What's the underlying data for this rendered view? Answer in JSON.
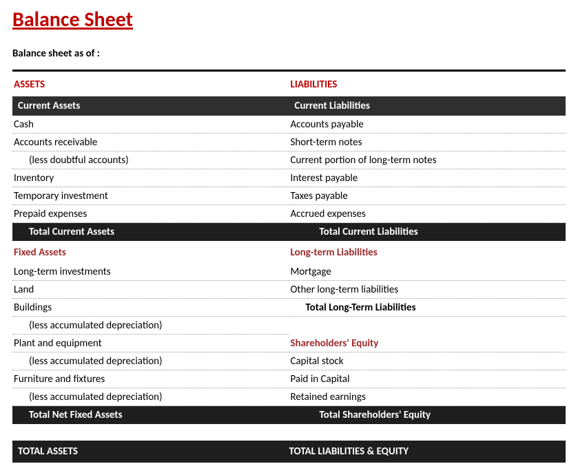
{
  "title": "Balance Sheet",
  "subtitle": "Balance sheet as of :",
  "assets": {
    "heading": "ASSETS",
    "current": {
      "band": "Current Assets",
      "rows": [
        {
          "label": "Cash",
          "indent": false
        },
        {
          "label": "Accounts receivable",
          "indent": false
        },
        {
          "label": "(less doubtful accounts)",
          "indent": true
        },
        {
          "label": "Inventory",
          "indent": false
        },
        {
          "label": "Temporary investment",
          "indent": false
        },
        {
          "label": "Prepaid expenses",
          "indent": false
        }
      ],
      "subtotal": "Total Current Assets"
    },
    "fixed": {
      "heading": "Fixed Assets",
      "rows": [
        {
          "label": "Long-term investments",
          "indent": false
        },
        {
          "label": "Land",
          "indent": false
        },
        {
          "label": "Buildings",
          "indent": false
        },
        {
          "label": "(less accumulated depreciation)",
          "indent": true
        },
        {
          "label": "Plant and equipment",
          "indent": false
        },
        {
          "label": "(less accumulated depreciation)",
          "indent": true
        },
        {
          "label": "Furniture and fixtures",
          "indent": false
        },
        {
          "label": "(less accumulated depreciation)",
          "indent": true
        }
      ],
      "subtotal": "Total Net Fixed Assets"
    },
    "total": "TOTAL ASSETS"
  },
  "liabilities": {
    "heading": "LIABILITIES",
    "current": {
      "band": "Current Liabilities",
      "rows": [
        {
          "label": "Accounts payable",
          "indent": false
        },
        {
          "label": "Short-term notes",
          "indent": false
        },
        {
          "label": "Current portion of long-term notes",
          "indent": false
        },
        {
          "label": "Interest payable",
          "indent": false
        },
        {
          "label": "Taxes payable",
          "indent": false
        },
        {
          "label": "Accrued expenses",
          "indent": false
        }
      ],
      "subtotal": "Total Current Liabilities"
    },
    "longterm": {
      "heading": "Long-term Liabilities",
      "rows": [
        {
          "label": "Mortgage",
          "indent": false
        },
        {
          "label": "Other long-term liabilities",
          "indent": false
        }
      ],
      "subtotal": "Total Long-Term Liabilities"
    },
    "equity": {
      "heading": "Shareholders' Equity",
      "rows": [
        {
          "label": "Capital stock",
          "indent": false
        },
        {
          "label": "Paid in Capital",
          "indent": false
        },
        {
          "label": "Retained earnings",
          "indent": false
        }
      ],
      "subtotal": "Total Shareholders' Equity"
    },
    "total": "TOTAL LIABILITIES & EQUITY"
  }
}
